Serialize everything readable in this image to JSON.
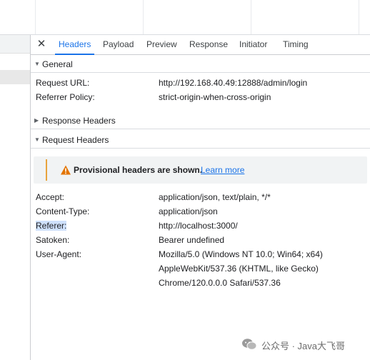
{
  "tabs": [
    {
      "label": "Headers",
      "active": true
    },
    {
      "label": "Payload"
    },
    {
      "label": "Preview"
    },
    {
      "label": "Response"
    },
    {
      "label": "Initiator"
    },
    {
      "label": "Timing"
    }
  ],
  "close_icon": "close-icon",
  "general": {
    "title": "General",
    "rows": [
      {
        "key": "Request URL:",
        "value": "http://192.168.40.49:12888/admin/login"
      },
      {
        "key": "Referrer Policy:",
        "value": "strict-origin-when-cross-origin"
      }
    ]
  },
  "response_headers": {
    "title": "Response Headers"
  },
  "request_headers": {
    "title": "Request Headers",
    "warning": {
      "icon": "warning-icon",
      "message": "Provisional headers are shown.",
      "link": "Learn more",
      "color": "#e8a33d"
    },
    "rows": [
      {
        "key": "Accept:",
        "value": "application/json, text/plain, */*"
      },
      {
        "key": "Content-Type:",
        "value": "application/json"
      },
      {
        "key": "Referer:",
        "value": "http://localhost:3000/"
      },
      {
        "key": "Satoken:",
        "value": "Bearer undefined"
      },
      {
        "key": "User-Agent:",
        "value_lines": [
          "Mozilla/5.0 (Windows NT 10.0; Win64; x64)",
          "AppleWebKit/537.36 (KHTML, like Gecko)",
          "Chrome/120.0.0.0 Safari/537.36"
        ]
      }
    ]
  },
  "accent_color": "#1a73e8",
  "watermark": {
    "text": "公众号 · Java大飞哥",
    "icon": "wechat-icon"
  }
}
